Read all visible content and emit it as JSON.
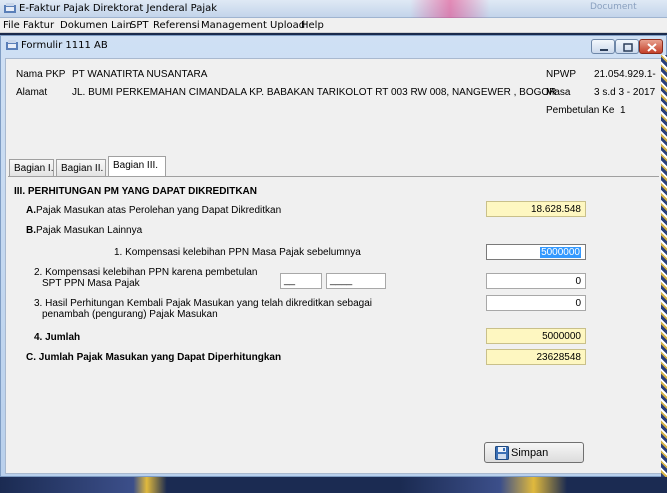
{
  "app": {
    "title": "E-Faktur Pajak Direktorat Jenderal Pajak"
  },
  "menu": [
    "File",
    "Faktur",
    "Dokumen Lain",
    "SPT",
    "Referensi",
    "Management Upload",
    "Help"
  ],
  "form": {
    "title": "Formulir 1111 AB",
    "nama_pkp_label": "Nama PKP",
    "nama_pkp_value": "PT WANATIRTA NUSANTARA",
    "alamat_label": "Alamat",
    "alamat_value": "JL. BUMI PERKEMAHAN CIMANDALA KP. BABAKAN TARIKOLOT RT 003 RW 008, NANGEWER , BOGOR",
    "npwp_label": "NPWP",
    "npwp_value": "21.054.929.1-",
    "masa_label": "Masa",
    "masa_value": "3 s.d 3 - 2017",
    "pembetulan_label": "Pembetulan Ke",
    "pembetulan_value": "1"
  },
  "tabs": [
    "Bagian I.",
    "Bagian II.",
    "Bagian III."
  ],
  "bagian3": {
    "section_title": "III. PERHITUNGAN PM YANG DAPAT DIKREDITKAN",
    "a_letter": "A.",
    "a_label": "Pajak Masukan atas Perolehan yang Dapat Dikreditkan",
    "a_value": "18.628.548",
    "b_letter": "B.",
    "b_label": "Pajak Masukan Lainnya",
    "b1_label": "1. Kompensasi kelebihan PPN Masa Pajak sebelumnya",
    "b1_value": "5000000",
    "b2_label_line1": "2. Kompensasi kelebihan PPN karena pembetulan",
    "b2_label_line2": "SPT PPN Masa Pajak",
    "b2_masa": "__",
    "b2_tahun": "____",
    "b2_value": "0",
    "b3_label_line1": "3. Hasil Perhitungan Kembali Pajak Masukan yang telah dikreditkan sebagai",
    "b3_label_line2": "penambah (pengurang) Pajak Masukan",
    "b3_value": "0",
    "b4_label": "4. Jumlah",
    "b4_value": "5000000",
    "c_label": "C. Jumlah Pajak Masukan yang Dapat Diperhitungkan",
    "c_value": "23628548"
  },
  "buttons": {
    "simpan": "Simpan"
  },
  "background": {
    "right_text": "Document"
  },
  "icons": {
    "app": "efaktur-app-icon",
    "save": "floppy-disk-icon"
  },
  "colors": {
    "highlight_field": "#fef7c1",
    "selection": "#3399ff",
    "close_button": "#c4402a"
  }
}
